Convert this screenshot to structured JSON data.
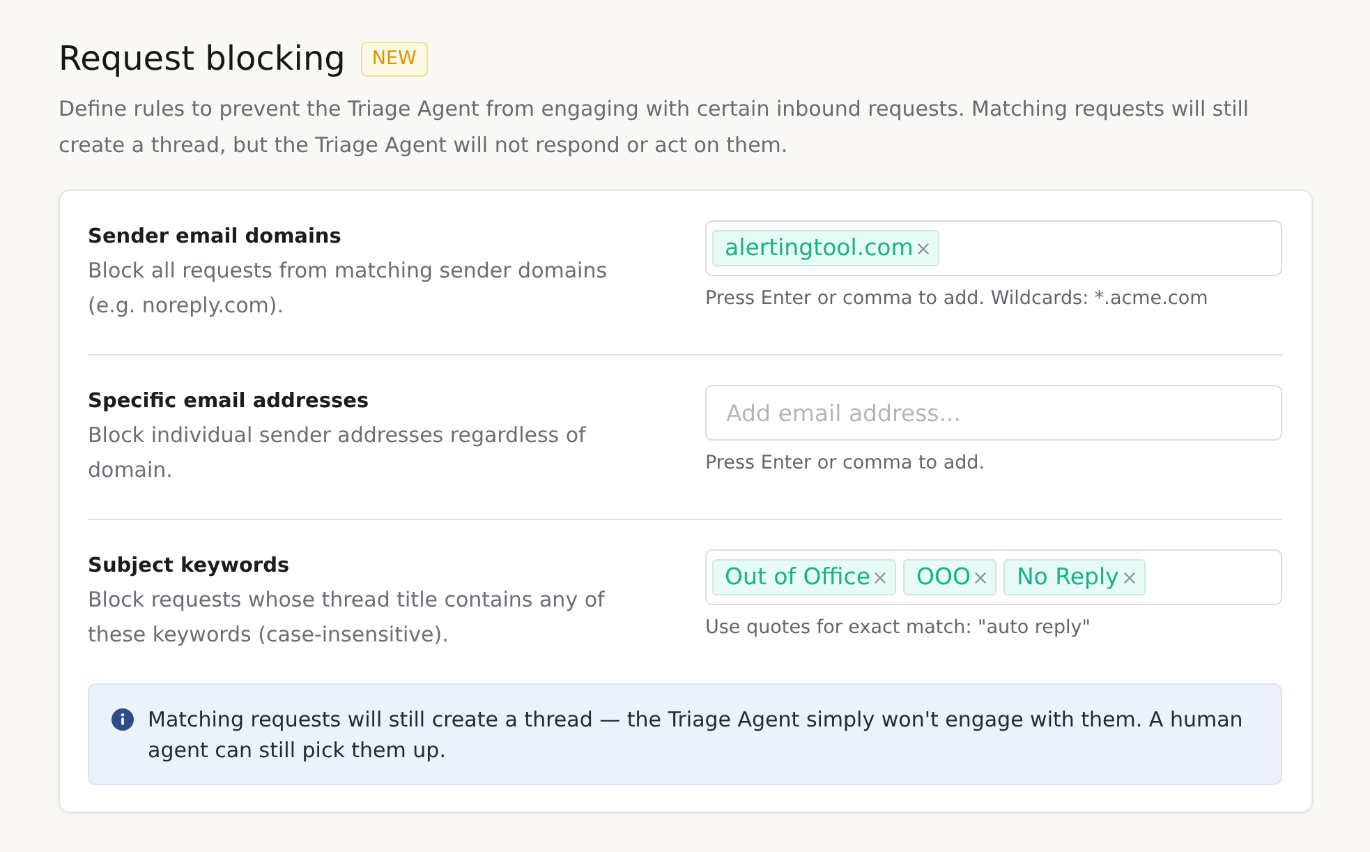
{
  "header": {
    "title": "Request blocking",
    "badge": "NEW",
    "description": "Define rules to prevent the Triage Agent from engaging with certain inbound requests. Matching requests will still create a thread, but the Triage Agent will not respond or act on them."
  },
  "rules": [
    {
      "title": "Sender email domains",
      "description": "Block all requests from matching sender domains (e.g. noreply.com).",
      "field": {
        "tags": [
          "alertingtool.com"
        ]
      },
      "hint": "Press Enter or comma to add. Wildcards: *.acme.com"
    },
    {
      "title": "Specific email addresses",
      "description": "Block individual sender addresses regardless of domain.",
      "field": {
        "placeholder": "Add email address..."
      },
      "hint": "Press Enter or comma to add."
    },
    {
      "title": "Subject keywords",
      "description": "Block requests whose thread title contains any of these keywords (case-insensitive).",
      "field": {
        "tags": [
          "Out of Office",
          "OOO",
          "No Reply"
        ]
      },
      "hint": "Use quotes for exact match: \"auto reply\""
    }
  ],
  "info": {
    "text": "Matching requests will still create a thread — the Triage Agent simply won't engage with them. A human agent can still pick them up."
  }
}
